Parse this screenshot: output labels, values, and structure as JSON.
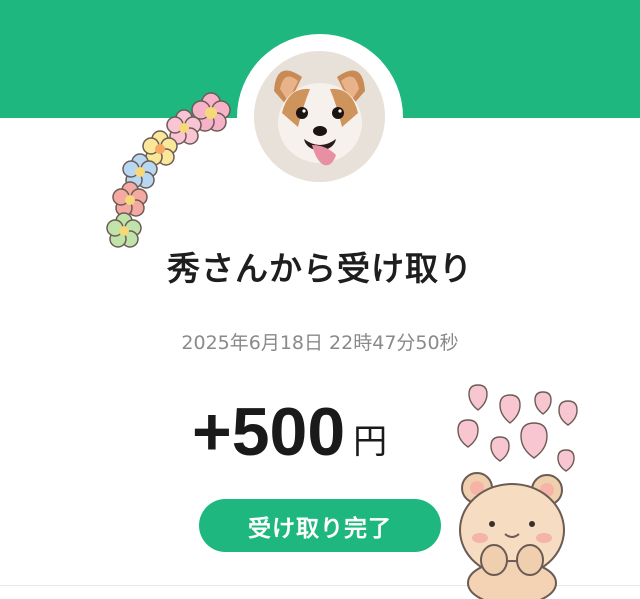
{
  "transfer": {
    "title": "秀さんから受け取り",
    "datetime": "2025年6月18日 22時47分50秒",
    "amount": "+500",
    "currency": "円",
    "status": "受け取り完了"
  },
  "colors": {
    "accent": "#1db77f",
    "text": "#1e1e1e",
    "muted": "#8a8a8a"
  },
  "icons": {
    "avatar": "dog-avatar",
    "decor_left": "flower-garland-sticker",
    "decor_right": "bear-hearts-sticker"
  }
}
